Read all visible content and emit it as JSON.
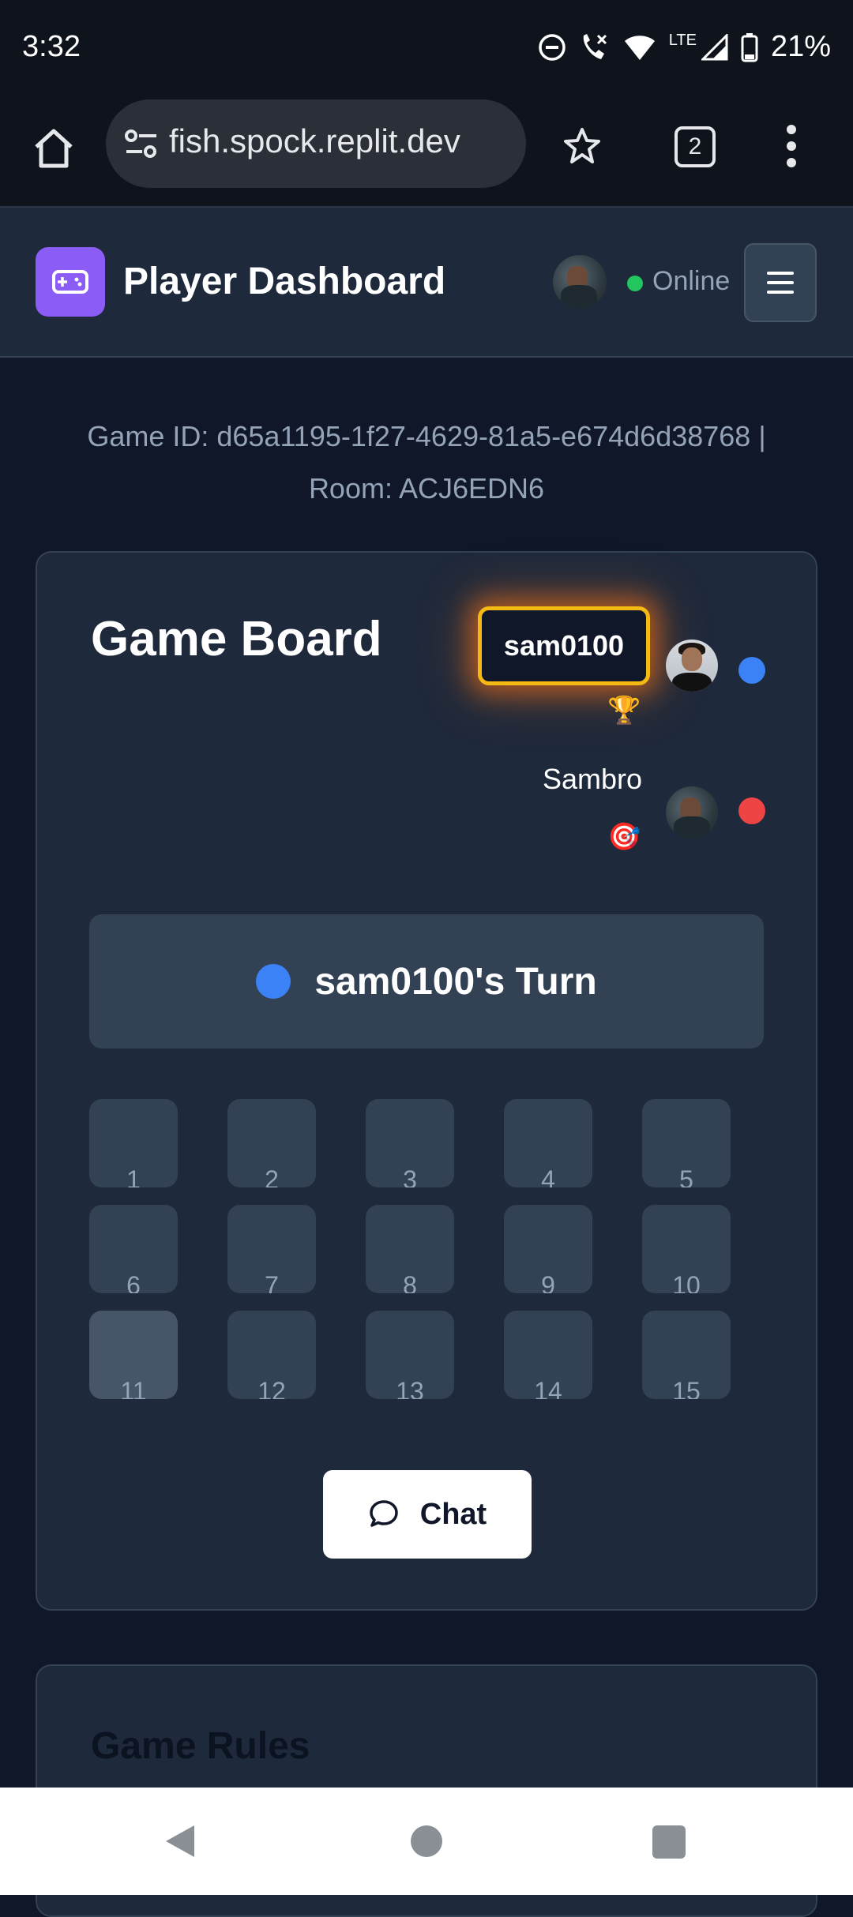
{
  "status_bar": {
    "time": "3:32",
    "network": "LTE",
    "battery": "21%"
  },
  "browser": {
    "url": "fish.spock.replit.dev",
    "tab_count": "2"
  },
  "header": {
    "title": "Player Dashboard",
    "status": "Online",
    "status_color": "#22c55e",
    "accent": "#8b5cf6"
  },
  "game": {
    "meta_line1": "Game ID: d65a1195-1f27-4629-81a5-e674d6d38768 |",
    "meta_line2": "Room: ACJ6EDN6"
  },
  "board": {
    "title": "Game Board",
    "players": [
      {
        "name": "sam0100",
        "color": "#3b82f6",
        "icon": "trophy-icon",
        "active": true
      },
      {
        "name": "Sambro",
        "color": "#ef4444",
        "icon": "target-icon",
        "active": false
      }
    ],
    "turn_text": "sam0100's Turn",
    "cells": [
      "1",
      "2",
      "3",
      "4",
      "5",
      "6",
      "7",
      "8",
      "9",
      "10",
      "11",
      "12",
      "13",
      "14",
      "15"
    ],
    "chat_label": "Chat"
  },
  "rules": {
    "title": "Game Rules"
  }
}
